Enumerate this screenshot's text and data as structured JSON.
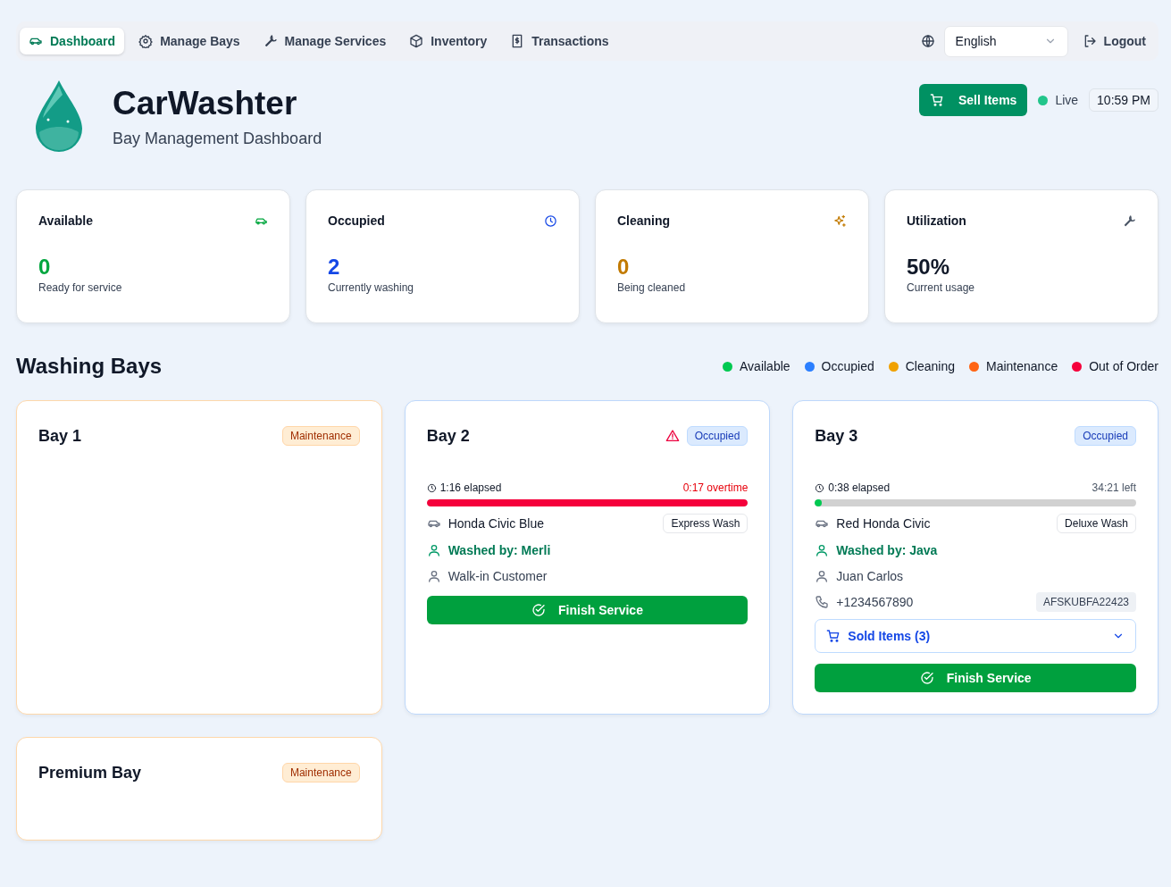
{
  "nav": {
    "tabs": [
      {
        "label": "Dashboard",
        "kind": "car",
        "selected": true
      },
      {
        "label": "Manage Bays",
        "kind": "gear",
        "selected": false
      },
      {
        "label": "Manage Services",
        "kind": "wrench",
        "selected": false
      },
      {
        "label": "Inventory",
        "kind": "box",
        "selected": false
      },
      {
        "label": "Transactions",
        "kind": "receipt",
        "selected": false
      }
    ],
    "language": "English",
    "logout": "Logout"
  },
  "header": {
    "title": "CarWashter",
    "subtitle": "Bay Management Dashboard",
    "sell_button": "Sell Items",
    "live": "Live",
    "time": "10:59 PM"
  },
  "stats": [
    {
      "kind": "available",
      "title": "Available",
      "value": "0",
      "caption": "Ready for service"
    },
    {
      "kind": "occupied",
      "title": "Occupied",
      "value": "2",
      "caption": "Currently washing"
    },
    {
      "kind": "cleaning",
      "title": "Cleaning",
      "value": "0",
      "caption": "Being cleaned"
    },
    {
      "kind": "utilization",
      "title": "Utilization",
      "value": "50%",
      "caption": "Current usage"
    }
  ],
  "bays_section": {
    "title": "Washing Bays",
    "legend": [
      {
        "label": "Available",
        "color": "#00c951"
      },
      {
        "label": "Occupied",
        "color": "#2b7fff"
      },
      {
        "label": "Cleaning",
        "color": "#f0a100"
      },
      {
        "label": "Maintenance",
        "color": "#ff6414"
      },
      {
        "label": "Out of Order",
        "color": "#f5003b"
      }
    ]
  },
  "bays": [
    {
      "name": "Bay 1",
      "kind": "maintenance",
      "badge": "Maintenance"
    },
    {
      "name": "Bay 2",
      "kind": "occupied",
      "badge": "Occupied",
      "alert": true,
      "elapsed": "1:16 elapsed",
      "remaining": "0:17 overtime",
      "overtime": true,
      "level": 1,
      "vehicle": "Honda Civic Blue",
      "service": "Express Wash",
      "washer": "Washed by: Merli",
      "customer": "Walk-in Customer",
      "finish": "Finish Service"
    },
    {
      "name": "Bay 3",
      "kind": "occupied",
      "badge": "Occupied",
      "alert": false,
      "elapsed": "0:38 elapsed",
      "remaining": "34:21 left",
      "overtime": false,
      "level": 0.02,
      "vehicle": "Red Honda Civic",
      "service": "Deluxe Wash",
      "washer": "Washed by: Java",
      "customer": "Juan Carlos",
      "phone": "+1234567890",
      "code": "AFSKUBFA22423",
      "sold_items": {
        "label": "Sold Items (3)",
        "expanded": false
      },
      "finish": "Finish Service"
    },
    {
      "name": "Premium Bay",
      "kind": "maintenance",
      "badge": "Maintenance"
    }
  ]
}
